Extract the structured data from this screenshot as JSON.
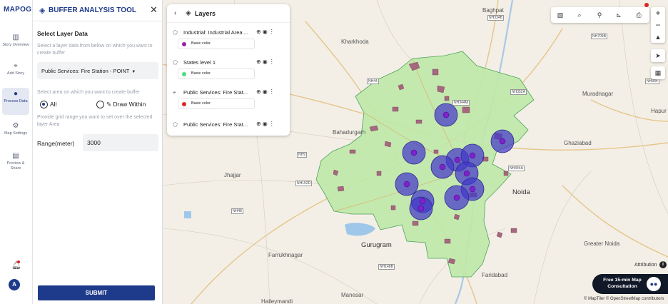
{
  "app": {
    "logo_text": "MAPOG",
    "tool_title": "BUFFER ANALYSIS TOOL",
    "close_glyph": "✕"
  },
  "rail": {
    "items": [
      {
        "label": "Story Overview",
        "icon": "book-icon"
      },
      {
        "label": "Add Story",
        "icon": "map-pin-icon"
      },
      {
        "label": "Process Data",
        "icon": "process-data-icon",
        "active": true
      },
      {
        "label": "Map Settings",
        "icon": "gear-icon"
      },
      {
        "label": "Preview & Share",
        "icon": "share-icon"
      }
    ],
    "avatar_initial": "A"
  },
  "panel": {
    "section_title": "Select Layer Data",
    "layer_hint": "Select a layer data from below on which you want to create buffer",
    "selected_layer": "Public Services: Fire Station - POINT",
    "area_hint": "Select area on which you want to create buffer",
    "radio_all": "All",
    "radio_draw": "Draw Within",
    "grid_hint": "Provide grid range you want to set over the selected layer Area",
    "range_label": "Range(meter)",
    "range_value": "3000",
    "submit_label": "SUBMIT"
  },
  "layers_panel": {
    "title": "Layers",
    "items": [
      {
        "name": "Industrial: Industrial Area ...",
        "color_label": "Basic color",
        "color": "#9c1fa8"
      },
      {
        "name": "States level 1",
        "color_label": "Basic color",
        "color": "#4ade80"
      },
      {
        "name": "Public Services: Fire Stat...",
        "color_label": "Basic color",
        "color": "#dc2626"
      },
      {
        "name": "Public Services: Fire Stat...",
        "color_label": "",
        "color": ""
      }
    ]
  },
  "map": {
    "places": [
      {
        "name": "Baghpat",
        "big": false
      },
      {
        "name": "Kharkhoda",
        "big": false
      },
      {
        "name": "Bahadurgarh",
        "big": false
      },
      {
        "name": "Jhajjar",
        "big": false
      },
      {
        "name": "Ghaziabad",
        "big": false
      },
      {
        "name": "Noida",
        "big": true
      },
      {
        "name": "Gurugram",
        "big": true
      },
      {
        "name": "Faridabad",
        "big": false
      },
      {
        "name": "Farrukhnagar",
        "big": false
      },
      {
        "name": "Manesar",
        "big": false
      },
      {
        "name": "Greater Noida",
        "big": false
      },
      {
        "name": "Muradnagar",
        "big": false
      },
      {
        "name": "Hapur",
        "big": false
      },
      {
        "name": "Haileymandi",
        "big": false
      }
    ],
    "road_tags": [
      "NH334B",
      "NH709B",
      "NH44",
      "NH352A",
      "NH9",
      "NH152D",
      "NH48",
      "NH148B",
      "NH334",
      "NH344A",
      "NH344M"
    ],
    "buffer_fill": "#4338ca",
    "state_fill": "#bfe8a8",
    "industrial_fill": "#a4687f"
  },
  "map_ui": {
    "attribution": "Attribution",
    "consult_text": "Free 15-min Map Consultation",
    "copyright": "© MapTiler © OpenStreetMap contributors"
  }
}
